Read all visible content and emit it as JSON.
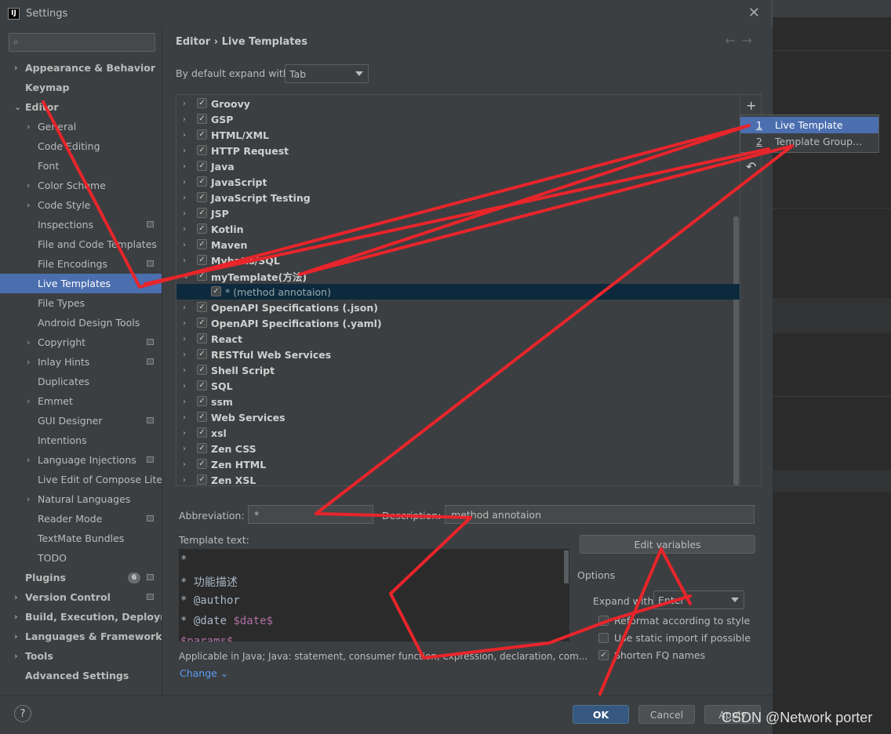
{
  "window": {
    "title": "Settings",
    "logo": "IJ"
  },
  "sidebar": {
    "items": [
      {
        "label": "Appearance & Behavior"
      },
      {
        "label": "Keymap"
      },
      {
        "label": "Editor"
      },
      {
        "label": "General"
      },
      {
        "label": "Code Editing"
      },
      {
        "label": "Font"
      },
      {
        "label": "Color Scheme"
      },
      {
        "label": "Code Style"
      },
      {
        "label": "Inspections"
      },
      {
        "label": "File and Code Templates"
      },
      {
        "label": "File Encodings"
      },
      {
        "label": "Live Templates"
      },
      {
        "label": "File Types"
      },
      {
        "label": "Android Design Tools"
      },
      {
        "label": "Copyright"
      },
      {
        "label": "Inlay Hints"
      },
      {
        "label": "Duplicates"
      },
      {
        "label": "Emmet"
      },
      {
        "label": "GUI Designer"
      },
      {
        "label": "Intentions"
      },
      {
        "label": "Language Injections"
      },
      {
        "label": "Live Edit of Compose Lite"
      },
      {
        "label": "Natural Languages"
      },
      {
        "label": "Reader Mode"
      },
      {
        "label": "TextMate Bundles"
      },
      {
        "label": "TODO"
      },
      {
        "label": "Plugins",
        "badge": "6"
      },
      {
        "label": "Version Control"
      },
      {
        "label": "Build, Execution, Deployme"
      },
      {
        "label": "Languages & Frameworks"
      },
      {
        "label": "Tools"
      },
      {
        "label": "Advanced Settings"
      }
    ]
  },
  "breadcrumb": {
    "part1": "Editor",
    "sep": "›",
    "part2": "Live Templates"
  },
  "expand": {
    "label": "By default expand with",
    "value": "Tab"
  },
  "templates": [
    "Groovy",
    "GSP",
    "HTML/XML",
    "HTTP Request",
    "Java",
    "JavaScript",
    "JavaScript Testing",
    "JSP",
    "Kotlin",
    "Maven",
    "Mybatis/SQL",
    "myTemplate(方法)",
    "* (method annotaion)",
    "OpenAPI Specifications (.json)",
    "OpenAPI Specifications (.yaml)",
    "React",
    "RESTful Web Services",
    "Shell Script",
    "SQL",
    "ssm",
    "Web Services",
    "xsl",
    "Zen CSS",
    "Zen HTML",
    "Zen XSL"
  ],
  "popup": {
    "items": [
      {
        "num": "1",
        "label": "Live Template"
      },
      {
        "num": "2",
        "label": "Template Group..."
      }
    ]
  },
  "form": {
    "abbr_label": "Abbreviation:",
    "abbr_value": "*",
    "desc_label": "Description:",
    "desc_value": "method annotaion",
    "template_label": "Template text:",
    "template_lines": {
      "l1": "*",
      "l2": " * 功能描述",
      "l3": " * @author",
      "l4a": " * @date ",
      "l4b": "$date$",
      "l5": "$params$"
    },
    "applicable": "Applicable in Java; Java: statement, consumer function, expression, declaration, com...",
    "change": "Change",
    "edit_vars": "Edit variables",
    "options_label": "Options",
    "expand_with_label": "Expand with",
    "expand_with_value": "Enter",
    "opt1": "Reformat according to style",
    "opt2": "Use static import if possible",
    "opt3": "Shorten FQ names"
  },
  "footer": {
    "help": "?",
    "ok": "OK",
    "cancel": "Cancel",
    "apply": "Apply"
  },
  "watermark": "CSDN @Network porter",
  "colors": {
    "selection": "#4b6eaf",
    "annotation": "#e8252b",
    "primary": "#365880"
  }
}
